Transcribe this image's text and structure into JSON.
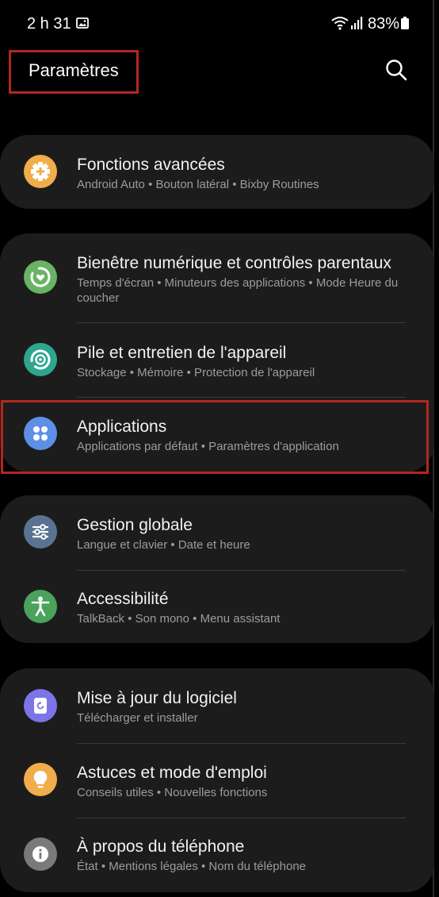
{
  "status_bar": {
    "time": "2 h 31",
    "battery": "83%"
  },
  "header": {
    "title": "Paramètres"
  },
  "colors": {
    "highlight": "#b3271e",
    "card_bg": "#1c1c1c",
    "subtitle": "#9c9c9c"
  },
  "items": [
    {
      "icon": "gear-plus-icon",
      "title": "Fonctions avancées",
      "subtitle": "Android Auto  •  Bouton latéral  •  Bixby Routines"
    },
    {
      "icon": "wellbeing-icon",
      "title": "Bienêtre numérique et contrôles parentaux",
      "subtitle": "Temps d'écran  •  Minuteurs des applications  •  Mode Heure du coucher"
    },
    {
      "icon": "device-care-icon",
      "title": "Pile et entretien de l'appareil",
      "subtitle": "Stockage  •  Mémoire  •  Protection de l'appareil"
    },
    {
      "icon": "apps-grid-icon",
      "title": "Applications",
      "subtitle": "Applications par défaut  •  Paramètres d'application"
    },
    {
      "icon": "sliders-icon",
      "title": "Gestion globale",
      "subtitle": "Langue et clavier  •  Date et heure"
    },
    {
      "icon": "accessibility-icon",
      "title": "Accessibilité",
      "subtitle": "TalkBack  •  Son mono  •  Menu assistant"
    },
    {
      "icon": "software-update-icon",
      "title": "Mise à jour du logiciel",
      "subtitle": "Télécharger et installer"
    },
    {
      "icon": "lightbulb-icon",
      "title": "Astuces et mode d'emploi",
      "subtitle": "Conseils utiles  •  Nouvelles fonctions"
    },
    {
      "icon": "info-icon",
      "title": "À propos du téléphone",
      "subtitle": "État  •  Mentions légales  •  Nom du téléphone"
    }
  ]
}
